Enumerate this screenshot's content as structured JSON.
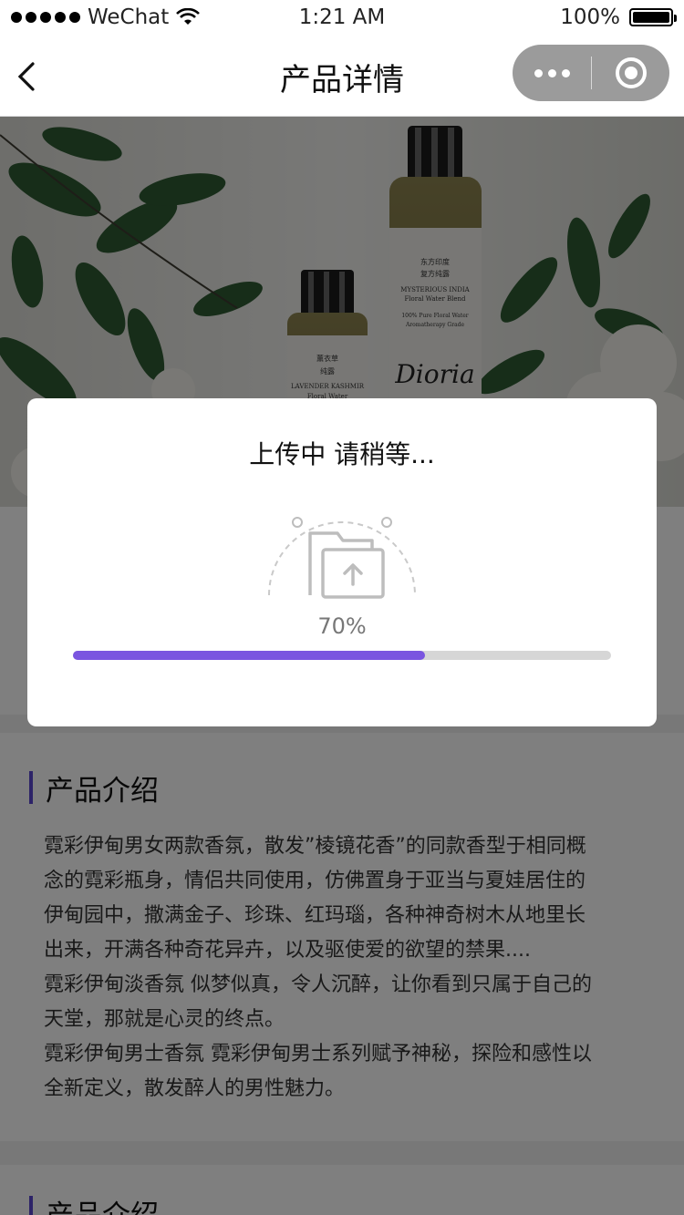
{
  "status_bar": {
    "carrier": "WeChat",
    "time": "1:21 AM",
    "battery": "100%"
  },
  "nav": {
    "title": "产品详情",
    "back_icon": "chevron-left-icon",
    "more_icon": "more-dots-icon",
    "close_icon": "target-close-icon"
  },
  "banner": {
    "bottle_small": {
      "lines": [
        "薰衣草",
        "纯露",
        "LAVENDER KASHMIR",
        "Floral Water"
      ]
    },
    "bottle_large": {
      "lines": [
        "东方印度",
        "复方纯露",
        "MYSTERIOUS INDIA",
        "Floral Water Blend",
        "100% Pure Floral Water",
        "Aromatherapy Grade"
      ],
      "brand": "Dioria"
    }
  },
  "sections": [
    {
      "title": "产品介绍",
      "paragraphs": [
        "霓彩伊甸男女两款香氛，散发”棱镜花香”的同款香型于相同概",
        "念的霓彩瓶身，情侣共同使用，仿佛置身于亚当与夏娃居住的",
        "伊甸园中，撒满金子、珍珠、红玛瑙，各种神奇树木从地里长",
        "出来，开满各种奇花异卉，以及驱使爱的欲望的禁果....",
        "霓彩伊甸淡香氛 似梦似真，令人沉醉，让你看到只属于自己的",
        "天堂，那就是心灵的终点。",
        "霓彩伊甸男士香氛 霓彩伊甸男士系列赋予神秘，探险和感性以",
        "全新定义，散发醉人的男性魅力。"
      ]
    },
    {
      "title": "产品介绍"
    }
  ],
  "modal": {
    "title": "上传中 请稍等...",
    "icon": "folder-upload-icon",
    "percent_label": "70%",
    "progress": 0.655,
    "accent": "#7a55e0"
  }
}
